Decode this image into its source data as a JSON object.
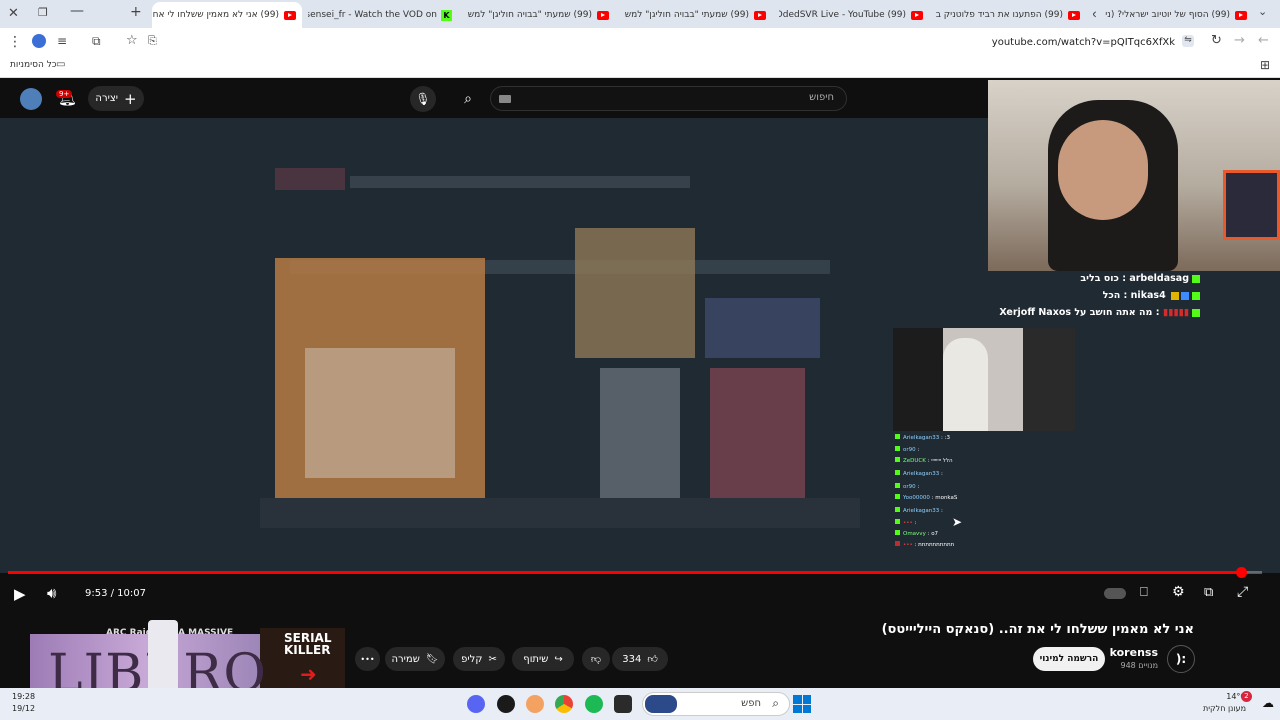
{
  "browser": {
    "tabs": [
      {
        "title": "(99) אני לא מאמין ששלחו לי אח",
        "icon": "youtube",
        "active": true
      },
      {
        "title": "sensei_fr - Watch the VOD on",
        "icon": "kick",
        "active": false
      },
      {
        "title": "(99) שמעתי \"בבויה חוליגן\" למש",
        "icon": "youtube",
        "active": false
      },
      {
        "title": "(99) שמעתי \"בבויה חוליגן\" למש",
        "icon": "youtube",
        "active": false
      },
      {
        "title": "(99) OdedSVR Live - YouTube",
        "icon": "youtube",
        "active": false
      },
      {
        "title": "(99) הפתענו את רביד פלוטניק ב",
        "icon": "youtube",
        "active": false
      },
      {
        "title": "(99) הסוף של יוטיוב ישראלי? (ני",
        "icon": "youtube",
        "active": false
      }
    ],
    "url": "youtube.com/watch?v=pQITqc6XfXk",
    "bookmarks_label": "כל הסימניות"
  },
  "youtube": {
    "search_placeholder": "חיפוש",
    "create_label": "יצירה",
    "notifications_badge": "9+",
    "video_time": "9:53 / 10:07",
    "progress_fraction": 0.983,
    "title": "אני לא מאמין ששלחו לי את זה.. (סנאקס הייליייטס)",
    "channel": {
      "name": "korenss",
      "subs": "948 מנויים",
      "avatar_text": "):"
    },
    "subscribe_label": "הרשמה למינוי",
    "likes": "334",
    "share_label": "שיתוף",
    "clip_label": "קליפ",
    "save_label": "שמירה",
    "more_label": "•••",
    "next_video": "ARC Raiders - A MASSIVE"
  },
  "stream_chat": [
    {
      "user": "arbeldasag",
      "msg": "כוס בליב"
    },
    {
      "user": "nikas4",
      "msg": "הכל"
    },
    {
      "user": "Xerjoff Naxos",
      "msg": "מה אתה חושב על"
    }
  ],
  "inner_chat": [
    {
      "user": "Arielkagan33",
      "msg": ":3"
    },
    {
      "user": "or90",
      "msg": ""
    },
    {
      "user": "ZeDUCK",
      "msg": "הלל יייייייי"
    },
    {
      "user": "Arielkagan33",
      "msg": ""
    },
    {
      "user": "or90",
      "msg": ""
    },
    {
      "user": "Yoo00000",
      "msg": "monkaS"
    },
    {
      "user": "Arielkagan33",
      "msg": ""
    },
    {
      "user": "•••",
      "msg": ""
    },
    {
      "user": "Omavvy",
      "msg": "o7"
    },
    {
      "user": "•••",
      "msg": "תתתתתתתתתת"
    }
  ],
  "ad": {
    "brand": "LIBERO",
    "thumb_text": "SERIAL KILLER"
  },
  "taskbar": {
    "search_placeholder": "חפש",
    "time": "19:28",
    "date": "19/12",
    "weather_temp": "14°C",
    "weather_desc": "מעונן חלקית",
    "notif_count": "2"
  }
}
